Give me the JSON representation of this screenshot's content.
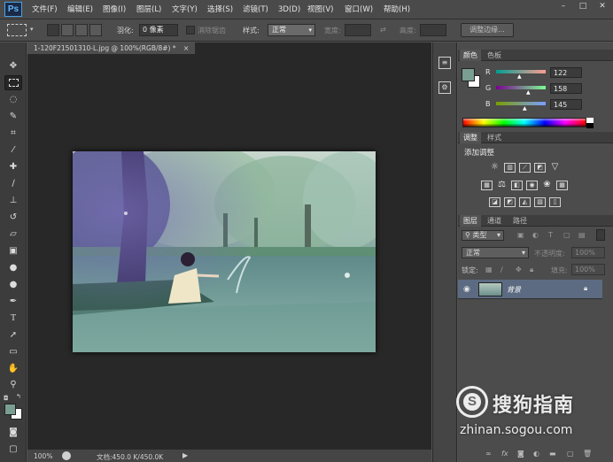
{
  "app": {
    "logo": "Ps"
  },
  "menu": [
    "文件(F)",
    "编辑(E)",
    "图像(I)",
    "图层(L)",
    "文字(Y)",
    "选择(S)",
    "滤镜(T)",
    "3D(D)",
    "视图(V)",
    "窗口(W)",
    "帮助(H)"
  ],
  "window_controls": [
    "–",
    "□",
    "✕"
  ],
  "options": {
    "feather_label": "羽化:",
    "feather_value": "0 像素",
    "antialias_label": "消除锯齿",
    "style_label": "样式:",
    "style_value": "正常",
    "width_label": "宽度:",
    "height_label": "高度:",
    "refine_button": "调整边缘..."
  },
  "document": {
    "tab_title": "1-120F21501310-L.jpg @ 100%(RGB/8#) *",
    "tab_close": "×",
    "zoom": "100%",
    "doc_info": "文档:450.0 K/450.0K"
  },
  "color_panel": {
    "tabs": [
      "颜色",
      "色板"
    ],
    "channels": [
      {
        "label": "R",
        "value": "122"
      },
      {
        "label": "G",
        "value": "158"
      },
      {
        "label": "B",
        "value": "145"
      }
    ],
    "foreground": "#7a9e91",
    "background": "#ffffff"
  },
  "adjustments_panel": {
    "tabs": [
      "调整",
      "样式"
    ],
    "title": "添加调整"
  },
  "layers_panel": {
    "tabs": [
      "图层",
      "通道",
      "路径"
    ],
    "filter_label": "类型",
    "blend_mode": "正常",
    "opacity_label": "不透明度:",
    "opacity_value": "100%",
    "lock_label": "锁定:",
    "fill_label": "填充:",
    "fill_value": "100%",
    "layers": [
      {
        "name": "背景",
        "locked": true,
        "visible": true
      }
    ]
  },
  "watermark": {
    "brand": "搜狗指南",
    "url": "zhinan.sogou.com"
  }
}
